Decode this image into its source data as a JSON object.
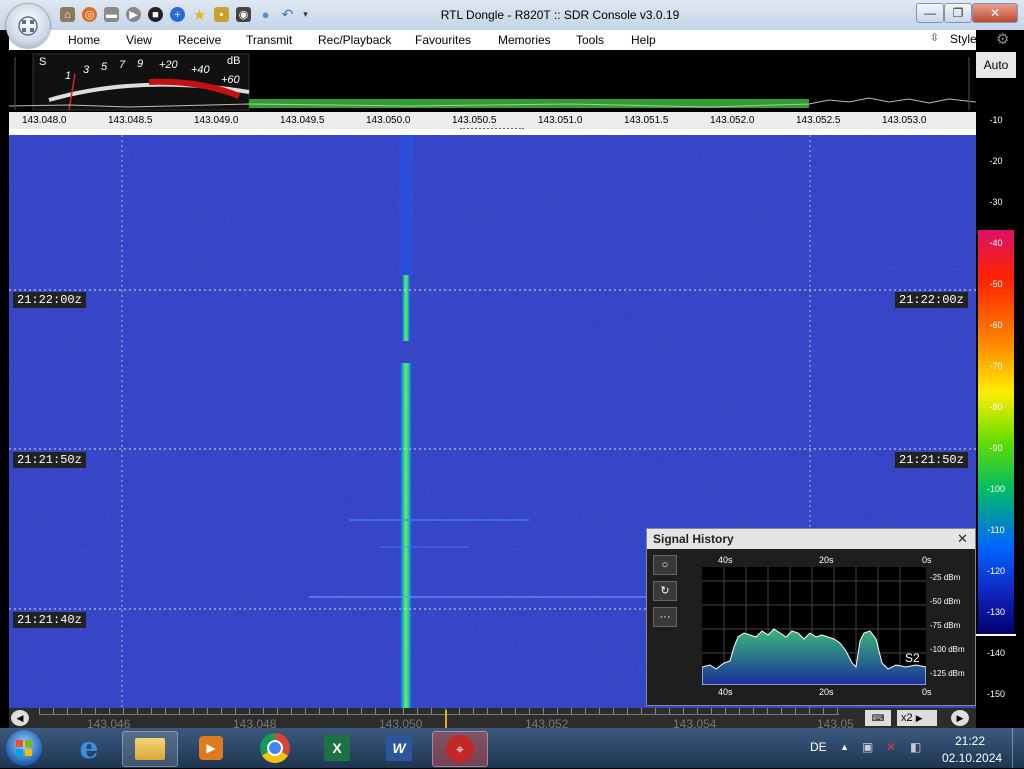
{
  "window": {
    "title": "RTL Dongle - R820T :: SDR Console v3.0.19"
  },
  "quick_access": [
    "home-icon",
    "lifebuoy-icon",
    "folder-icon",
    "play-icon",
    "stop-icon",
    "plus-icon",
    "star-icon",
    "lock-icon",
    "camera-icon",
    "drop-icon",
    "undo-icon",
    "dropdown-icon"
  ],
  "menu": {
    "items": [
      "Home",
      "View",
      "Receive",
      "Transmit",
      "Rec/Playback",
      "Favourites",
      "Memories",
      "Tools",
      "Help"
    ],
    "style": "Style"
  },
  "meter": {
    "s_label": "S",
    "s_ticks": [
      "1",
      "3",
      "5",
      "7",
      "9"
    ],
    "plus_ticks": [
      "+20",
      "+40",
      "+60"
    ],
    "unit": "dB"
  },
  "freq_axis": [
    "143.048.0",
    "143.048.5",
    "143.049.0",
    "143.049.5",
    "143.050.0",
    "143.050.5",
    "143.051.0",
    "143.051.5",
    "143.052.0",
    "143.052.5",
    "143.053.0"
  ],
  "auto_label": "Auto",
  "db_scale": [
    "-10",
    "-20",
    "-30",
    "-40",
    "-50",
    "-60",
    "-70",
    "-80",
    "-90",
    "-100",
    "-110",
    "-120",
    "-130",
    "-140",
    "-150"
  ],
  "timestamps": [
    "21:22:00z",
    "21:21:50z",
    "21:21:40z"
  ],
  "bottom_freqs": [
    "143.046",
    "143.048",
    "143.050",
    "143.052",
    "143.054",
    "143.05"
  ],
  "zoom_label": "x2",
  "signal_history": {
    "title": "Signal History",
    "top_time": [
      "40s",
      "20s",
      "0s"
    ],
    "bottom_time": [
      "40s",
      "20s",
      "0s"
    ],
    "levels": [
      "-25 dBm",
      "-50 dBm",
      "-75 dBm",
      "-100 dBm",
      "-125 dBm"
    ],
    "s_reading": "S2",
    "buttons": [
      "record-circle-icon",
      "refresh-icon",
      "more-icon"
    ],
    "more_label": "···"
  },
  "taskbar": {
    "apps": [
      "windows-start-icon",
      "internet-explorer-icon",
      "file-explorer-icon",
      "media-player-icon",
      "chrome-icon",
      "excel-icon",
      "word-icon",
      "sdr-console-icon"
    ],
    "language": "DE",
    "time": "21:22",
    "date": "02.10.2024"
  },
  "colors": {
    "waterfall_bg": "#061066",
    "accent_green": "#2f9e2f",
    "meter_red": "#c81010"
  }
}
